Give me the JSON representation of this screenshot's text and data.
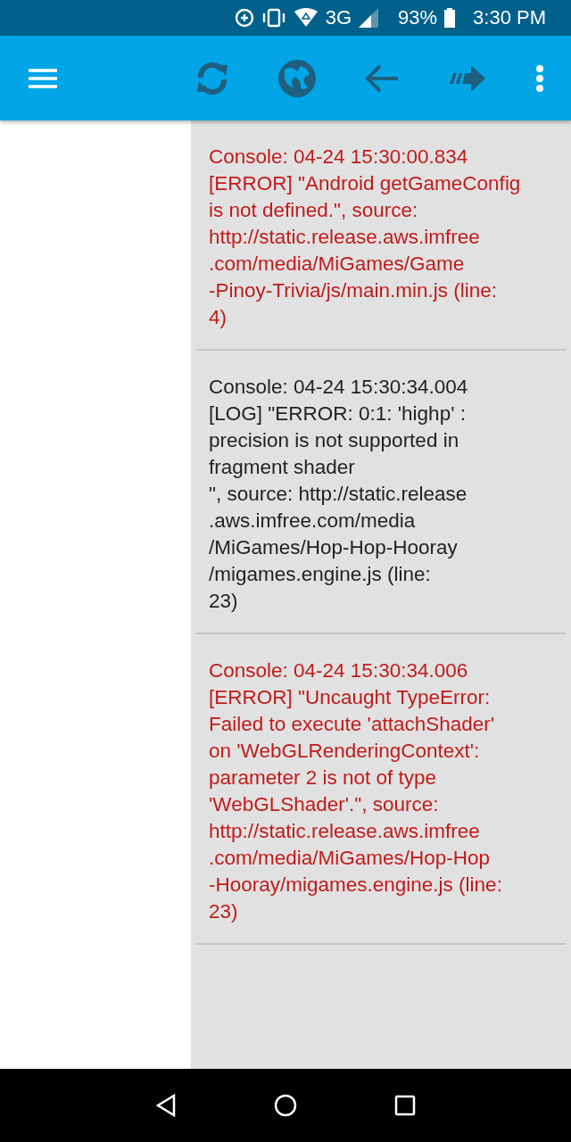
{
  "status_bar": {
    "network": "3G",
    "battery": "93%",
    "time": "3:30 PM"
  },
  "console": {
    "messages": [
      {
        "kind": "error",
        "lines": [
          "Console: 04-24 15:30:00.834",
          "[ERROR] \"Android getGameConfig",
          "is not defined.\", source:",
          "http://static.release.aws.imfree",
          ".com/media/MiGames/Game",
          "-Pinoy-Trivia/js/main.min.js (line:",
          "4)"
        ]
      },
      {
        "kind": "log",
        "lines": [
          "Console: 04-24 15:30:34.004",
          "[LOG] \"ERROR: 0:1: 'highp' :",
          "precision is not supported in",
          "fragment shader",
          "\", source: http://static.release",
          ".aws.imfree.com/media",
          "/MiGames/Hop-Hop-Hooray",
          "/migames.engine.js (line:",
          "23)"
        ]
      },
      {
        "kind": "error",
        "lines": [
          "Console: 04-24 15:30:34.006",
          "[ERROR] \"Uncaught TypeError:",
          "Failed to execute 'attachShader'",
          "on 'WebGLRenderingContext':",
          "parameter 2 is not of type",
          "'WebGLShader'.\", source:",
          "http://static.release.aws.imfree",
          ".com/media/MiGames/Hop-Hop",
          "-Hooray/migames.engine.js (line:",
          "23)"
        ]
      }
    ]
  }
}
